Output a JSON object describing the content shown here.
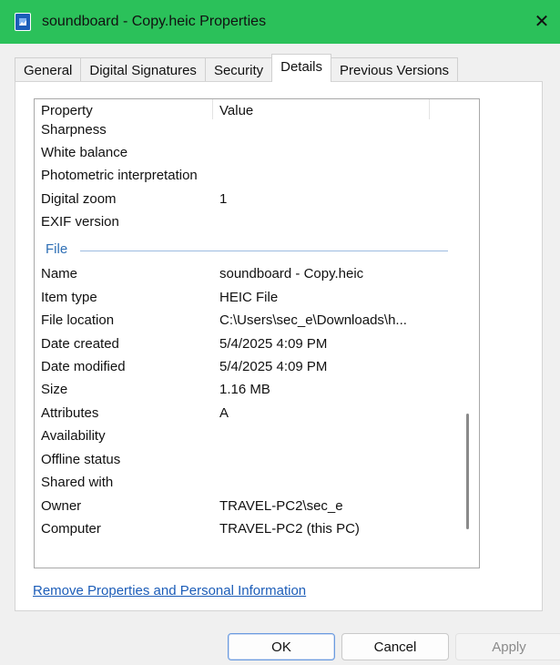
{
  "window": {
    "title": "soundboard - Copy.heic Properties",
    "close_glyph": "✕"
  },
  "tabs": [
    {
      "label": "General"
    },
    {
      "label": "Digital Signatures"
    },
    {
      "label": "Security"
    },
    {
      "label": "Details",
      "active": true
    },
    {
      "label": "Previous Versions"
    }
  ],
  "list": {
    "header": {
      "property": "Property",
      "value": "Value"
    },
    "rows_top": [
      {
        "key": "Sharpness",
        "value": ""
      },
      {
        "key": "White balance",
        "value": ""
      },
      {
        "key": "Photometric interpretation",
        "value": ""
      },
      {
        "key": "Digital zoom",
        "value": "1"
      },
      {
        "key": "EXIF version",
        "value": ""
      }
    ],
    "group_label": "File",
    "rows_file": [
      {
        "key": "Name",
        "value": "soundboard - Copy.heic"
      },
      {
        "key": "Item type",
        "value": "HEIC File"
      },
      {
        "key": "File location",
        "value": "C:\\Users\\sec_e\\Downloads\\h..."
      },
      {
        "key": "Date created",
        "value": "5/4/2025 4:09 PM"
      },
      {
        "key": "Date modified",
        "value": "5/4/2025 4:09 PM"
      },
      {
        "key": "Size",
        "value": "1.16 MB"
      },
      {
        "key": "Attributes",
        "value": "A"
      },
      {
        "key": "Availability",
        "value": ""
      },
      {
        "key": "Offline status",
        "value": ""
      },
      {
        "key": "Shared with",
        "value": ""
      },
      {
        "key": "Owner",
        "value": "TRAVEL-PC2\\sec_e"
      },
      {
        "key": "Computer",
        "value": "TRAVEL-PC2 (this PC)"
      }
    ]
  },
  "remove_link": "Remove Properties and Personal Information",
  "buttons": {
    "ok": "OK",
    "cancel": "Cancel",
    "apply": "Apply"
  },
  "colors": {
    "titlebar": "#2bc15a",
    "link": "#1c5db8",
    "group_label": "#2e6fb5"
  }
}
